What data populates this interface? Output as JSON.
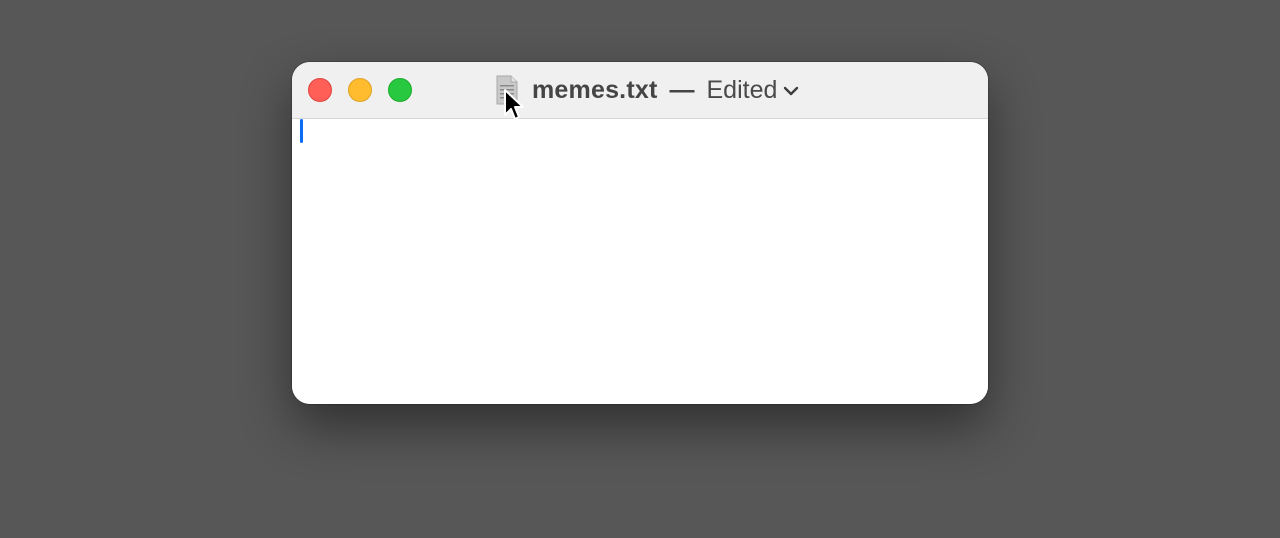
{
  "window": {
    "filename": "memes.txt",
    "separator": "—",
    "status": "Edited",
    "controls": {
      "close": "close",
      "minimize": "minimize",
      "zoom": "zoom"
    }
  },
  "editor": {
    "content": ""
  },
  "icons": {
    "document": "document-icon",
    "chevron": "chevron-down-icon",
    "cursor": "mouse-pointer-icon"
  },
  "colors": {
    "desktop": "#575757",
    "titlebar": "#f0f0f0",
    "close": "#ff5f57",
    "minimize": "#febc2e",
    "zoom": "#28c840",
    "caret": "#0a6ef5"
  }
}
